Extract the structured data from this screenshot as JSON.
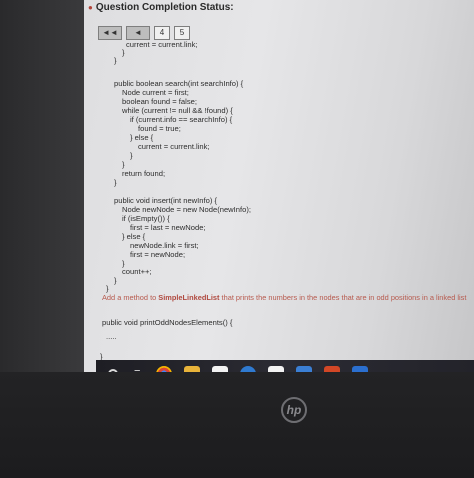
{
  "status_title": "Question Completion Status:",
  "pager": {
    "pages": [
      "4",
      "5"
    ]
  },
  "code_lines": [
    "current = current.link;",
    "}",
    "}",
    "public boolean search(int searchInfo) {",
    "Node current = first;",
    "boolean found = false;",
    "while (current != null && !found) {",
    "if (current.info == searchInfo) {",
    "found = true;",
    "} else {",
    "current = current.link;",
    "}",
    "}",
    "return found;",
    "}",
    "public void insert(int newInfo) {",
    "Node newNode = new Node(newInfo);",
    "if (isEmpty()) {",
    "first = last = newNode;",
    "} else {",
    "newNode.link = first;",
    "first = newNode;",
    "}",
    "count++;",
    "}",
    "}"
  ],
  "prompt": {
    "before": "Add a method to ",
    "bold": "SimpleLinkedList",
    "after": " that prints the numbers in the nodes that are in odd positions in a linked list"
  },
  "method_signature": "public void printOddNodesElements() {",
  "placeholder_dots": ".....",
  "closing_brace": "}",
  "colors": {
    "accent_red": "#b04a40",
    "taskbar": "#23232a"
  },
  "taskbar_icons": [
    "start-circle-icon",
    "task-view-icon",
    "chrome-icon",
    "file-explorer-icon",
    "calendar-icon",
    "edge-icon",
    "amazon-icon",
    "mail-icon",
    "office-icon",
    "store-icon"
  ],
  "hp_logo": "hp"
}
